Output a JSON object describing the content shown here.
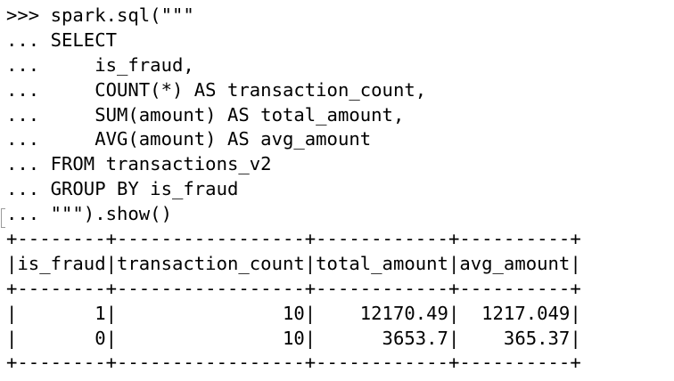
{
  "terminal": {
    "lines": [
      ">>> spark.sql(\"\"\"",
      "... SELECT",
      "...     is_fraud,",
      "...     COUNT(*) AS transaction_count,",
      "...     SUM(amount) AS total_amount,",
      "...     AVG(amount) AS avg_amount",
      "... FROM transactions_v2",
      "... GROUP BY is_fraud",
      "... \"\"\").show()",
      "+--------+-----------------+------------+----------+",
      "|is_fraud|transaction_count|total_amount|avg_amount|",
      "+--------+-----------------+------------+----------+",
      "|       1|               10|    12170.49|  1217.049|",
      "|       0|               10|      3653.7|    365.37|",
      "+--------+-----------------+------------+----------+"
    ]
  }
}
